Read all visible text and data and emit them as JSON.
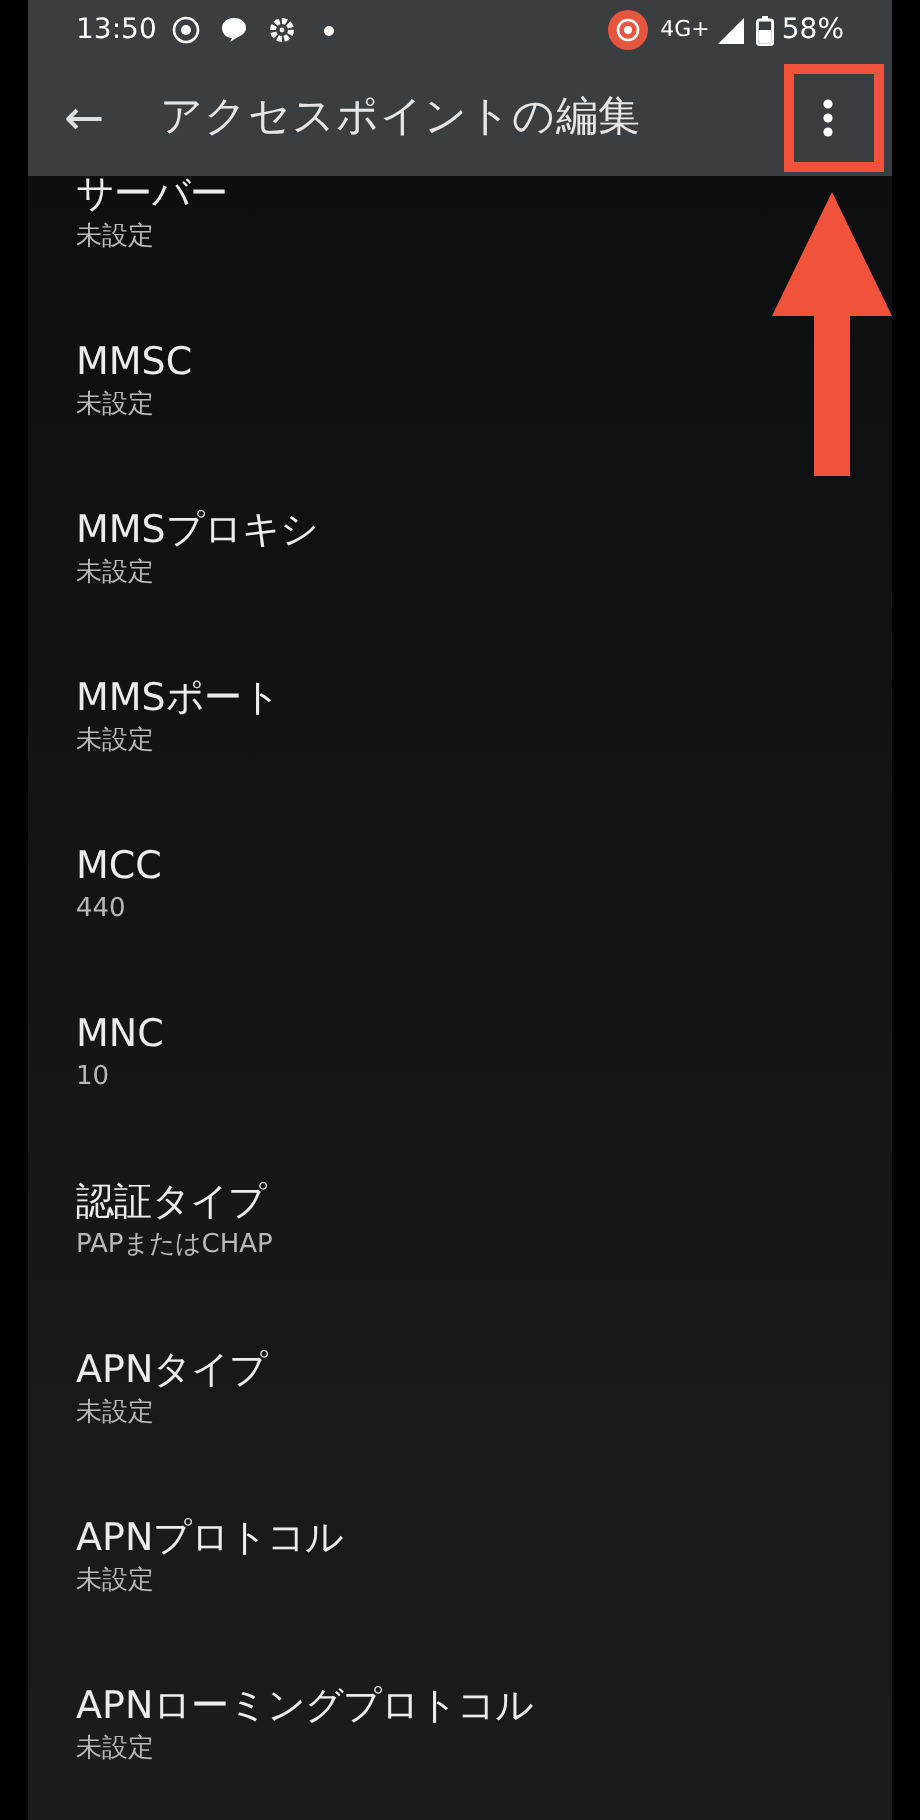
{
  "status_bar": {
    "time": "13:50",
    "network": "4G+",
    "battery": "58%"
  },
  "toolbar": {
    "back": "←",
    "title": "アクセスポイントの編集"
  },
  "settings": [
    {
      "title": "サーバー",
      "value": "未設定"
    },
    {
      "title": "MMSC",
      "value": "未設定"
    },
    {
      "title": "MMSプロキシ",
      "value": "未設定"
    },
    {
      "title": "MMSポート",
      "value": "未設定"
    },
    {
      "title": "MCC",
      "value": "440"
    },
    {
      "title": "MNC",
      "value": "10"
    },
    {
      "title": "認証タイプ",
      "value": "PAPまたはCHAP"
    },
    {
      "title": "APNタイプ",
      "value": "未設定"
    },
    {
      "title": "APNプロトコル",
      "value": "未設定"
    },
    {
      "title": "APNローミングプロトコル",
      "value": "未設定"
    }
  ]
}
